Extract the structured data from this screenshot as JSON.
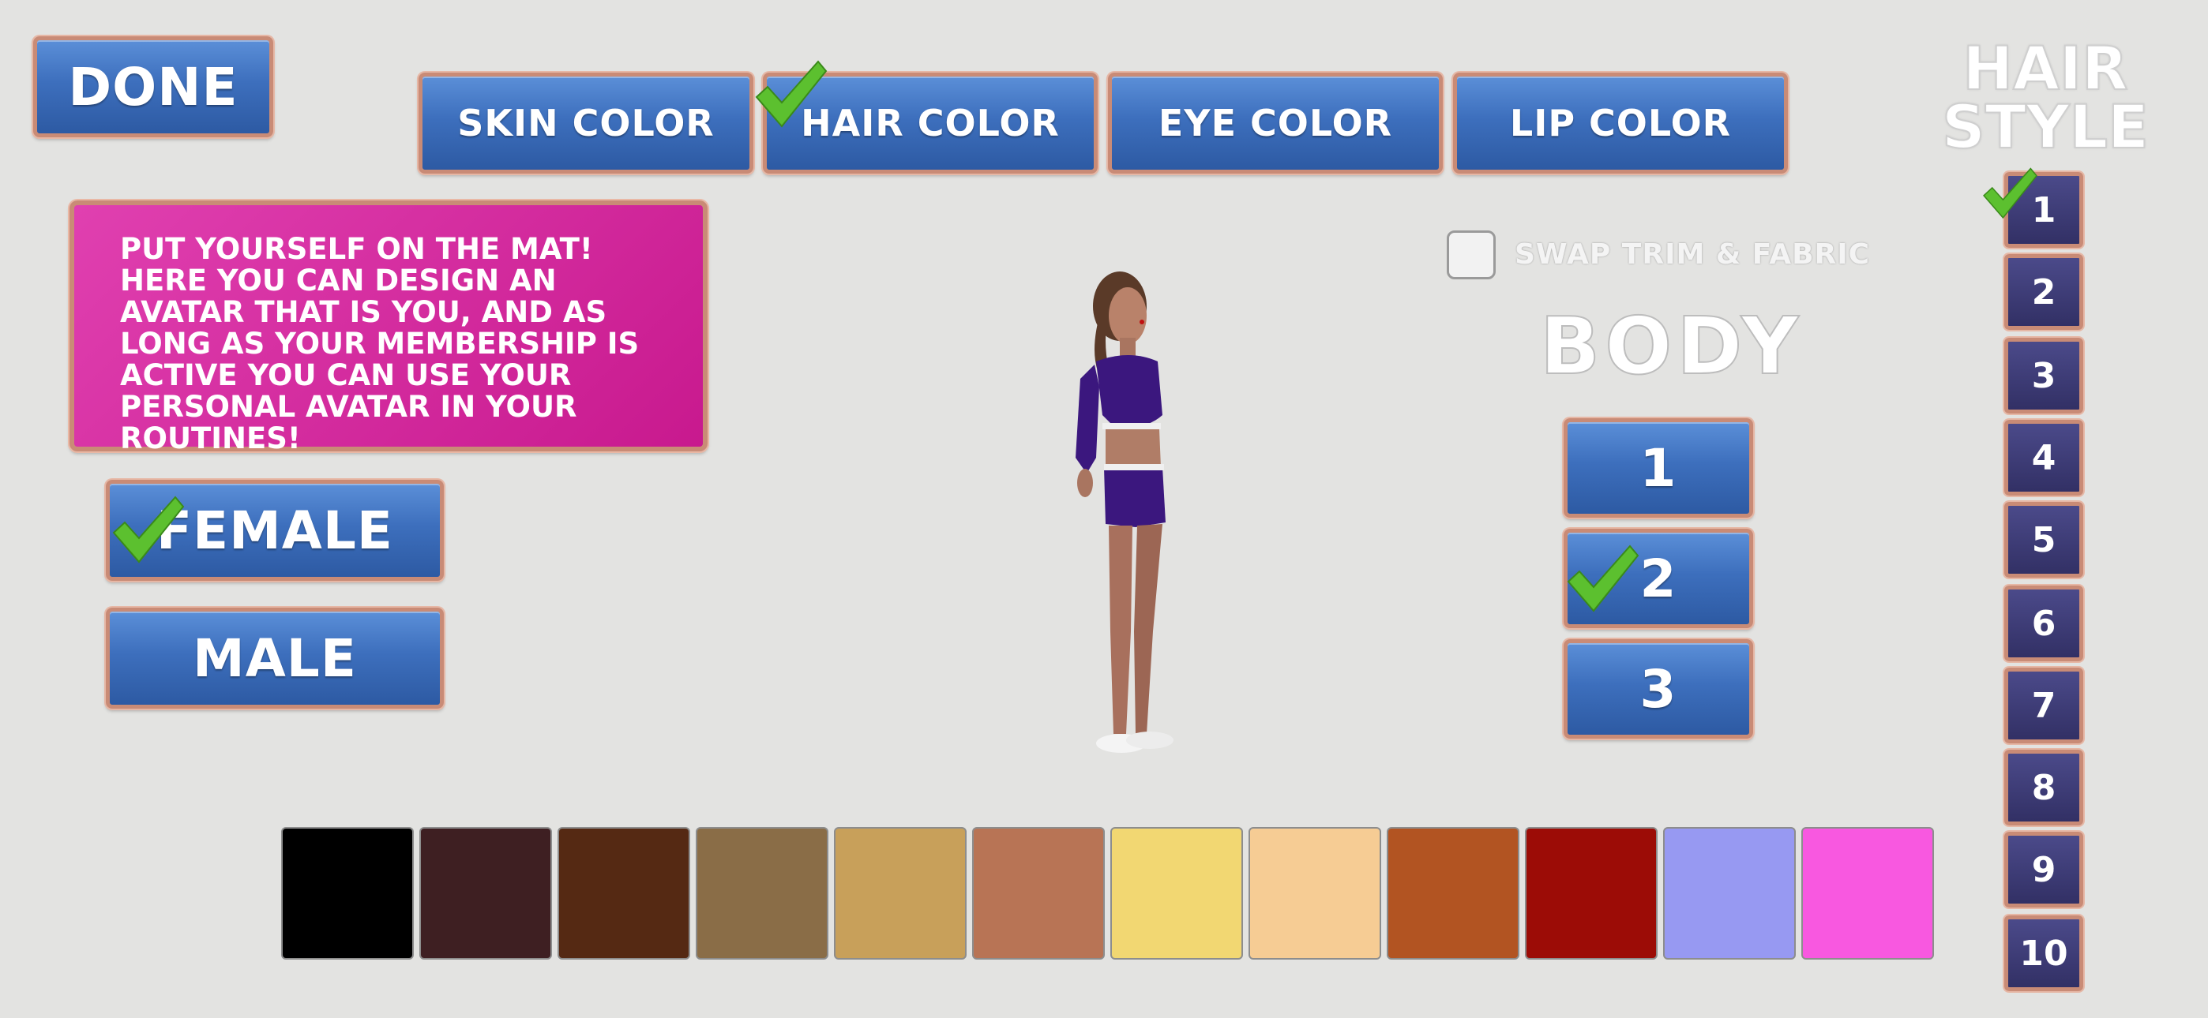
{
  "done_label": "DONE",
  "tabs": [
    {
      "label": "SKIN COLOR",
      "checked": false
    },
    {
      "label": "HAIR COLOR",
      "checked": true
    },
    {
      "label": "EYE COLOR",
      "checked": false
    },
    {
      "label": "LIP COLOR",
      "checked": false
    }
  ],
  "info_text": "PUT YOURSELF ON THE MAT! HERE YOU CAN DESIGN AN AVATAR THAT IS YOU, AND AS LONG AS YOUR MEMBERSHIP IS ACTIVE YOU CAN USE YOUR PERSONAL AVATAR IN YOUR ROUTINES!",
  "gender": {
    "female": "FEMALE",
    "male": "MALE",
    "selected": "female"
  },
  "swap_label": "SWAP TRIM & FABRIC",
  "body": {
    "title": "BODY",
    "options": [
      "1",
      "2",
      "3"
    ],
    "selected": "2"
  },
  "hair_style": {
    "title_line1": "HAIR",
    "title_line2": "STYLE",
    "options": [
      "1",
      "2",
      "3",
      "4",
      "5",
      "6",
      "7",
      "8",
      "9",
      "10"
    ],
    "selected": "1"
  },
  "swatches": [
    "#000000",
    "#3e1f22",
    "#552913",
    "#8a6d47",
    "#c8a05a",
    "#b87455",
    "#f2d772",
    "#f6cc94",
    "#b25422",
    "#9c0c06",
    "#9799f2",
    "#f858e0"
  ]
}
